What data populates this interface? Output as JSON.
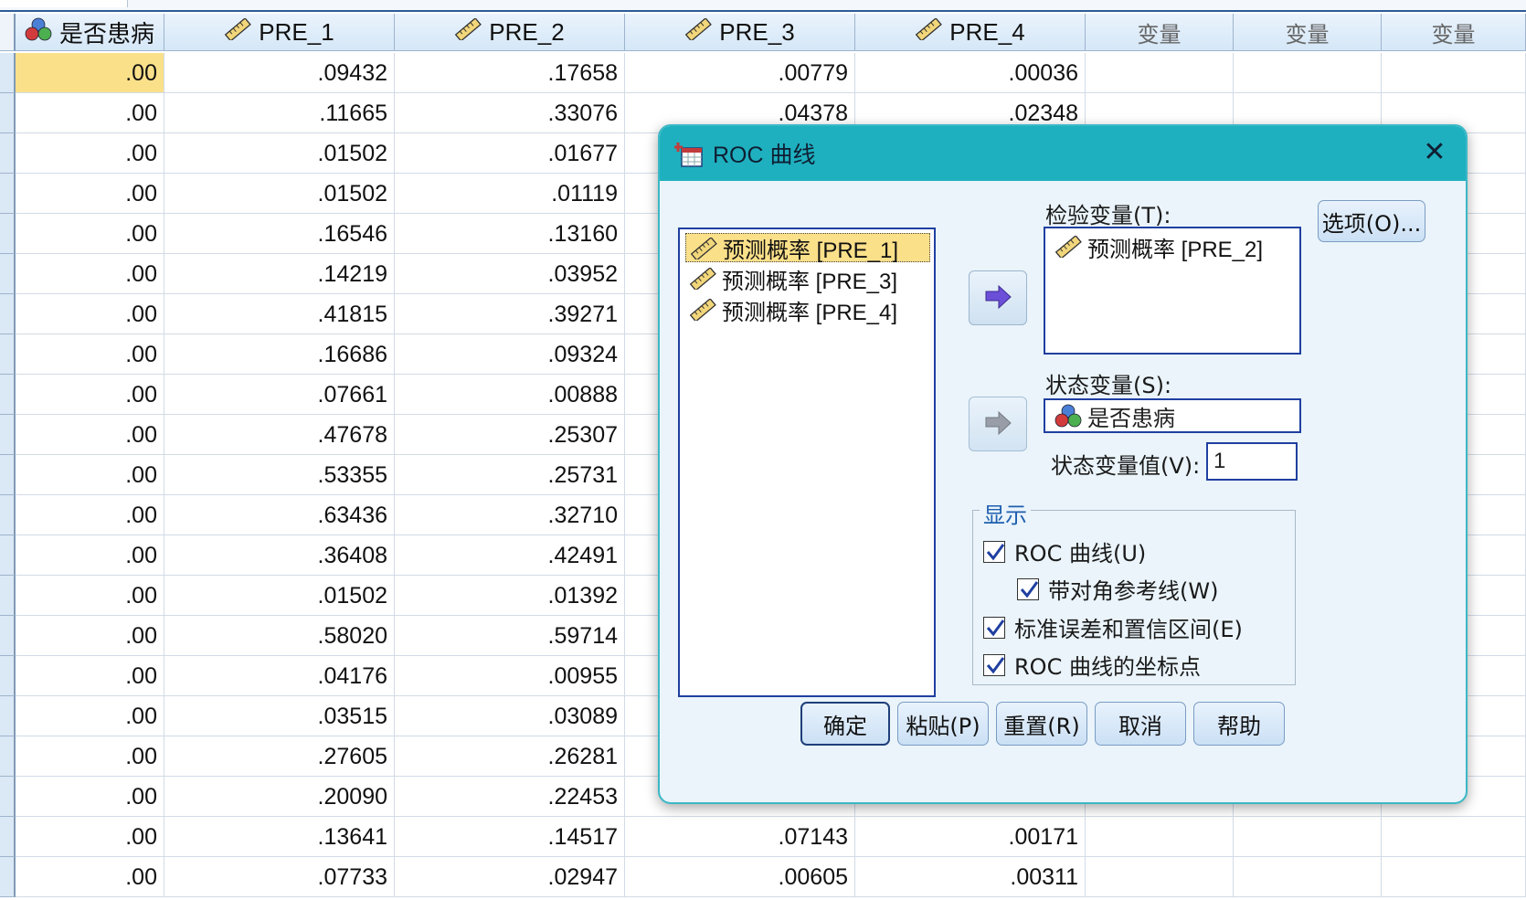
{
  "grid": {
    "columns": [
      {
        "label": "是否患病",
        "icon": "nominal-variable-icon"
      },
      {
        "label": "PRE_1",
        "icon": "scale-ruler-icon"
      },
      {
        "label": "PRE_2",
        "icon": "scale-ruler-icon"
      },
      {
        "label": "PRE_3",
        "icon": "scale-ruler-icon"
      },
      {
        "label": "PRE_4",
        "icon": "scale-ruler-icon"
      },
      {
        "label": "变量",
        "icon": ""
      },
      {
        "label": "变量",
        "icon": ""
      },
      {
        "label": "变量",
        "icon": ""
      }
    ],
    "rows": [
      [
        ".00",
        ".09432",
        ".17658",
        ".00779",
        ".00036"
      ],
      [
        ".00",
        ".11665",
        ".33076",
        ".04378",
        ".02348"
      ],
      [
        ".00",
        ".01502",
        ".01677",
        "",
        ""
      ],
      [
        ".00",
        ".01502",
        ".01119",
        "",
        ""
      ],
      [
        ".00",
        ".16546",
        ".13160",
        "",
        ""
      ],
      [
        ".00",
        ".14219",
        ".03952",
        "",
        ""
      ],
      [
        ".00",
        ".41815",
        ".39271",
        "",
        ""
      ],
      [
        ".00",
        ".16686",
        ".09324",
        "",
        ""
      ],
      [
        ".00",
        ".07661",
        ".00888",
        "",
        ""
      ],
      [
        ".00",
        ".47678",
        ".25307",
        "",
        ""
      ],
      [
        ".00",
        ".53355",
        ".25731",
        "",
        ""
      ],
      [
        ".00",
        ".63436",
        ".32710",
        "",
        ""
      ],
      [
        ".00",
        ".36408",
        ".42491",
        "",
        ""
      ],
      [
        ".00",
        ".01502",
        ".01392",
        "",
        ""
      ],
      [
        ".00",
        ".58020",
        ".59714",
        "",
        ""
      ],
      [
        ".00",
        ".04176",
        ".00955",
        "",
        ""
      ],
      [
        ".00",
        ".03515",
        ".03089",
        "",
        ""
      ],
      [
        ".00",
        ".27605",
        ".26281",
        "",
        ""
      ],
      [
        ".00",
        ".20090",
        ".22453",
        "",
        ""
      ],
      [
        ".00",
        ".13641",
        ".14517",
        ".07143",
        ".00171"
      ],
      [
        ".00",
        ".07733",
        ".02947",
        ".00605",
        ".00311"
      ]
    ]
  },
  "dialog": {
    "title": "ROC 曲线",
    "close_glyph": "✕",
    "source_list": [
      {
        "label": "预测概率 [PRE_1]",
        "selected": true
      },
      {
        "label": "预测概率 [PRE_3]",
        "selected": false
      },
      {
        "label": "预测概率 [PRE_4]",
        "selected": false
      }
    ],
    "test_variable_label": "检验变量(T):",
    "test_variables": [
      {
        "label": "预测概率 [PRE_2]"
      }
    ],
    "state_variable_label": "状态变量(S):",
    "state_variable": "是否患病",
    "state_value_label": "状态变量值(V):",
    "state_value": "1",
    "options_button": "选项(O)...",
    "display_group": {
      "legend": "显示",
      "roc_curve": {
        "label": "ROC 曲线(U)",
        "checked": true
      },
      "diagonal_ref": {
        "label": "带对角参考线(W)",
        "checked": true
      },
      "std_error_ci": {
        "label": "标准误差和置信区间(E)",
        "checked": true
      },
      "roc_coordinates": {
        "label": "ROC 曲线的坐标点",
        "checked": true
      }
    },
    "buttons": {
      "ok": "确定",
      "paste": "粘贴(P)",
      "reset": "重置(R)",
      "cancel": "取消",
      "help": "帮助"
    }
  },
  "colors": {
    "title_bar": "#1fb0bf",
    "selection": "#fbe08a",
    "header_bg": "#d5e7f7",
    "listbox_border": "#1f3fa0"
  }
}
